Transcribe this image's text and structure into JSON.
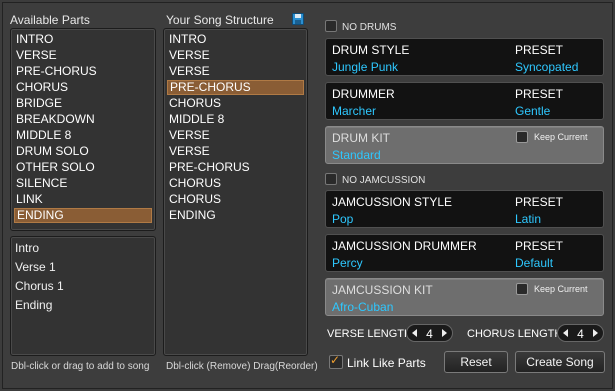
{
  "available_parts": {
    "title": "Available Parts",
    "items": [
      "INTRO",
      "VERSE",
      "PRE-CHORUS",
      "CHORUS",
      "BRIDGE",
      "BREAKDOWN",
      "MIDDLE 8",
      "DRUM SOLO",
      "OTHER SOLO",
      "SILENCE",
      "LINK",
      "ENDING"
    ],
    "selected": "ENDING",
    "recent": [
      "Intro",
      "Verse 1",
      "Chorus 1",
      "Ending"
    ],
    "hint": "Dbl-click or drag to add to song"
  },
  "song_structure": {
    "title": "Your Song Structure",
    "items": [
      "INTRO",
      "VERSE",
      "VERSE",
      "PRE-CHORUS",
      "CHORUS",
      "MIDDLE 8",
      "VERSE",
      "VERSE",
      "PRE-CHORUS",
      "CHORUS",
      "CHORUS",
      "ENDING"
    ],
    "selected_index": 3,
    "hint": "Dbl-click (Remove) Drag(Reorder)",
    "save_icon": "save-icon"
  },
  "drums": {
    "toggle_label": "NO DRUMS",
    "no_drums_checked": false,
    "style_label": "DRUM STYLE",
    "style_value": "Jungle Punk",
    "style_preset_label": "PRESET",
    "style_preset_value": "Syncopated",
    "drummer_label": "DRUMMER",
    "drummer_value": "Marcher",
    "drummer_preset_label": "PRESET",
    "drummer_preset_value": "Gentle",
    "kit_label": "DRUM KIT",
    "kit_value": "Standard",
    "keep_current_label": "Keep Current"
  },
  "jamcussion": {
    "toggle_label": "NO JAMCUSSION",
    "no_jamcussion_checked": false,
    "style_label": "JAMCUSSION STYLE",
    "style_value": "Pop",
    "style_preset_label": "PRESET",
    "style_preset_value": "Latin",
    "drummer_label": "JAMCUSSION DRUMMER",
    "drummer_value": "Percy",
    "drummer_preset_label": "PRESET",
    "drummer_preset_value": "Default",
    "kit_label": "JAMCUSSION KIT",
    "kit_value": "Afro-Cuban",
    "keep_current_label": "Keep Current"
  },
  "lengths": {
    "verse_label": "VERSE LENGTH",
    "verse_value": "4",
    "chorus_label": "CHORUS LENGTH",
    "chorus_value": "4"
  },
  "footer": {
    "link_like_parts_label": "Link Like Parts",
    "link_like_parts_checked": true,
    "reset_label": "Reset",
    "create_song_label": "Create Song"
  },
  "colors": {
    "accent_value": "#2ec8ff",
    "selection": "#8a5d35",
    "checkmark": "#f0a030"
  }
}
